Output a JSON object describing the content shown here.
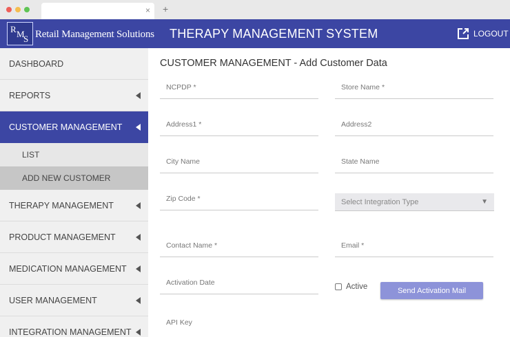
{
  "browser": {
    "tab_close": "×",
    "new_tab": "+"
  },
  "header": {
    "logo_letters": [
      "R",
      "M",
      "S"
    ],
    "logo_text": "Retail Management Solutions",
    "title": "THERAPY MANAGEMENT SYSTEM",
    "logout_label": "LOGOUT",
    "color": "#3c46a3"
  },
  "sidebar": {
    "items": [
      {
        "label": "DASHBOARD",
        "chevron": false
      },
      {
        "label": "REPORTS",
        "chevron": true
      },
      {
        "label": "CUSTOMER MANAGEMENT",
        "chevron": true,
        "active": true
      },
      {
        "label": "THERAPY MANAGEMENT",
        "chevron": true
      },
      {
        "label": "PRODUCT MANAGEMENT",
        "chevron": true
      },
      {
        "label": "MEDICATION MANAGEMENT",
        "chevron": true
      },
      {
        "label": "USER MANAGEMENT",
        "chevron": true
      },
      {
        "label": "INTEGRATION MANAGEMENT",
        "chevron": true
      }
    ],
    "sub_items": [
      {
        "label": "LIST"
      },
      {
        "label": "ADD NEW CUSTOMER",
        "selected": true
      }
    ]
  },
  "main": {
    "title": "CUSTOMER MANAGEMENT - Add Customer Data",
    "fields": {
      "ncpdp": "NCPDP *",
      "store_name": "Store Name *",
      "address1": "Address1 *",
      "address2": "Address2",
      "city": "City Name",
      "state": "State Name",
      "zip": "Zip Code *",
      "contact_name": "Contact Name *",
      "email": "Email *",
      "activation_date": "Activation Date",
      "api_key": "API Key"
    },
    "integration_select": {
      "value": "Select Integration Type",
      "caret": "▼"
    },
    "active_label": "Active",
    "active_checked": false,
    "send_button": "Send Activation Mail",
    "accent": "#8d93d9"
  }
}
